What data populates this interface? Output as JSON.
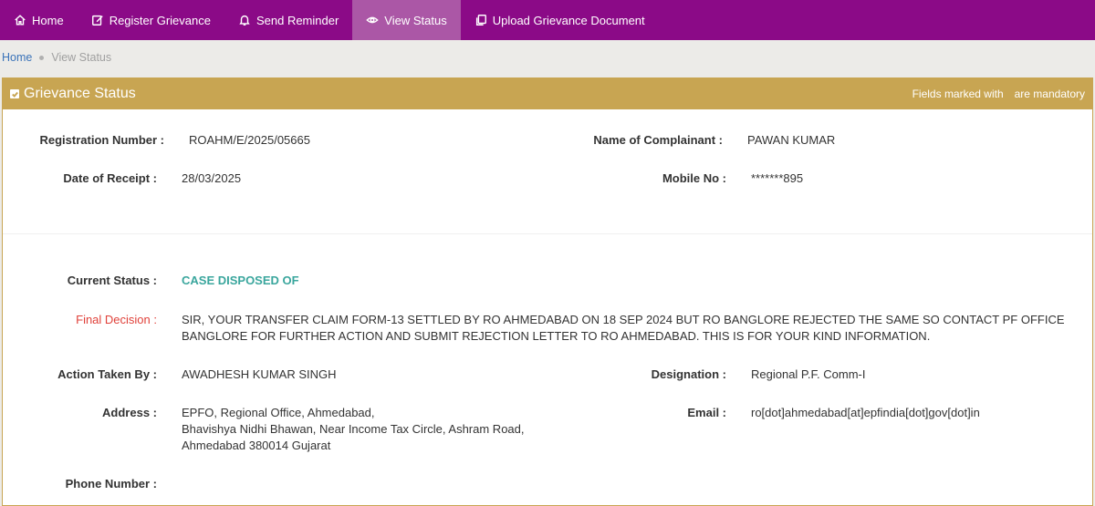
{
  "nav": {
    "items": [
      {
        "label": "Home",
        "icon": "home-icon"
      },
      {
        "label": "Register Grievance",
        "icon": "edit-icon"
      },
      {
        "label": "Send Reminder",
        "icon": "bell-icon"
      },
      {
        "label": "View Status",
        "icon": "eye-icon",
        "active": true
      },
      {
        "label": "Upload Grievance Document",
        "icon": "copy-document-icon"
      }
    ]
  },
  "breadcrumb": {
    "home": "Home",
    "current": "View Status"
  },
  "panel": {
    "title": "Grievance Status",
    "note_prefix": "Fields marked with",
    "note_suffix": "are mandatory"
  },
  "details": {
    "registration_label": "Registration Number :",
    "registration_value": "ROAHM/E/2025/05665",
    "complainant_label": "Name of Complainant :",
    "complainant_value": "PAWAN KUMAR",
    "receipt_label": "Date of Receipt :",
    "receipt_value": "28/03/2025",
    "mobile_label": "Mobile No :",
    "mobile_value": "*******895",
    "status_label": "Current Status :",
    "status_value": "CASE DISPOSED OF",
    "decision_label": "Final Decision :",
    "decision_value": "SIR, YOUR TRANSFER CLAIM FORM-13 SETTLED BY RO AHMEDABAD ON 18 SEP 2024 BUT RO BANGLORE REJECTED THE SAME SO CONTACT PF OFFICE BANGLORE FOR FURTHER ACTION AND SUBMIT REJECTION LETTER TO RO AHMEDABAD. THIS IS FOR YOUR KIND INFORMATION.",
    "action_label": "Action Taken By :",
    "action_value": "AWADHESH KUMAR SINGH",
    "designation_label": "Designation :",
    "designation_value": "Regional P.F. Comm-I",
    "address_label": "Address :",
    "address_line1": "EPFO, Regional Office, Ahmedabad,",
    "address_line2": "Bhavishya Nidhi Bhawan, Near Income Tax Circle, Ashram Road,",
    "address_line3": "Ahmedabad 380014 Gujarat",
    "email_label": "Email :",
    "email_value": "ro[dot]ahmedabad[at]epfindia[dot]gov[dot]in",
    "phone_label": "Phone Number :"
  },
  "colors": {
    "nav_bg": "#8b0a87",
    "nav_active": "#ab57a6",
    "panel_header": "#c8a552",
    "status": "#3aa69d",
    "decision_label": "#e0413a"
  }
}
